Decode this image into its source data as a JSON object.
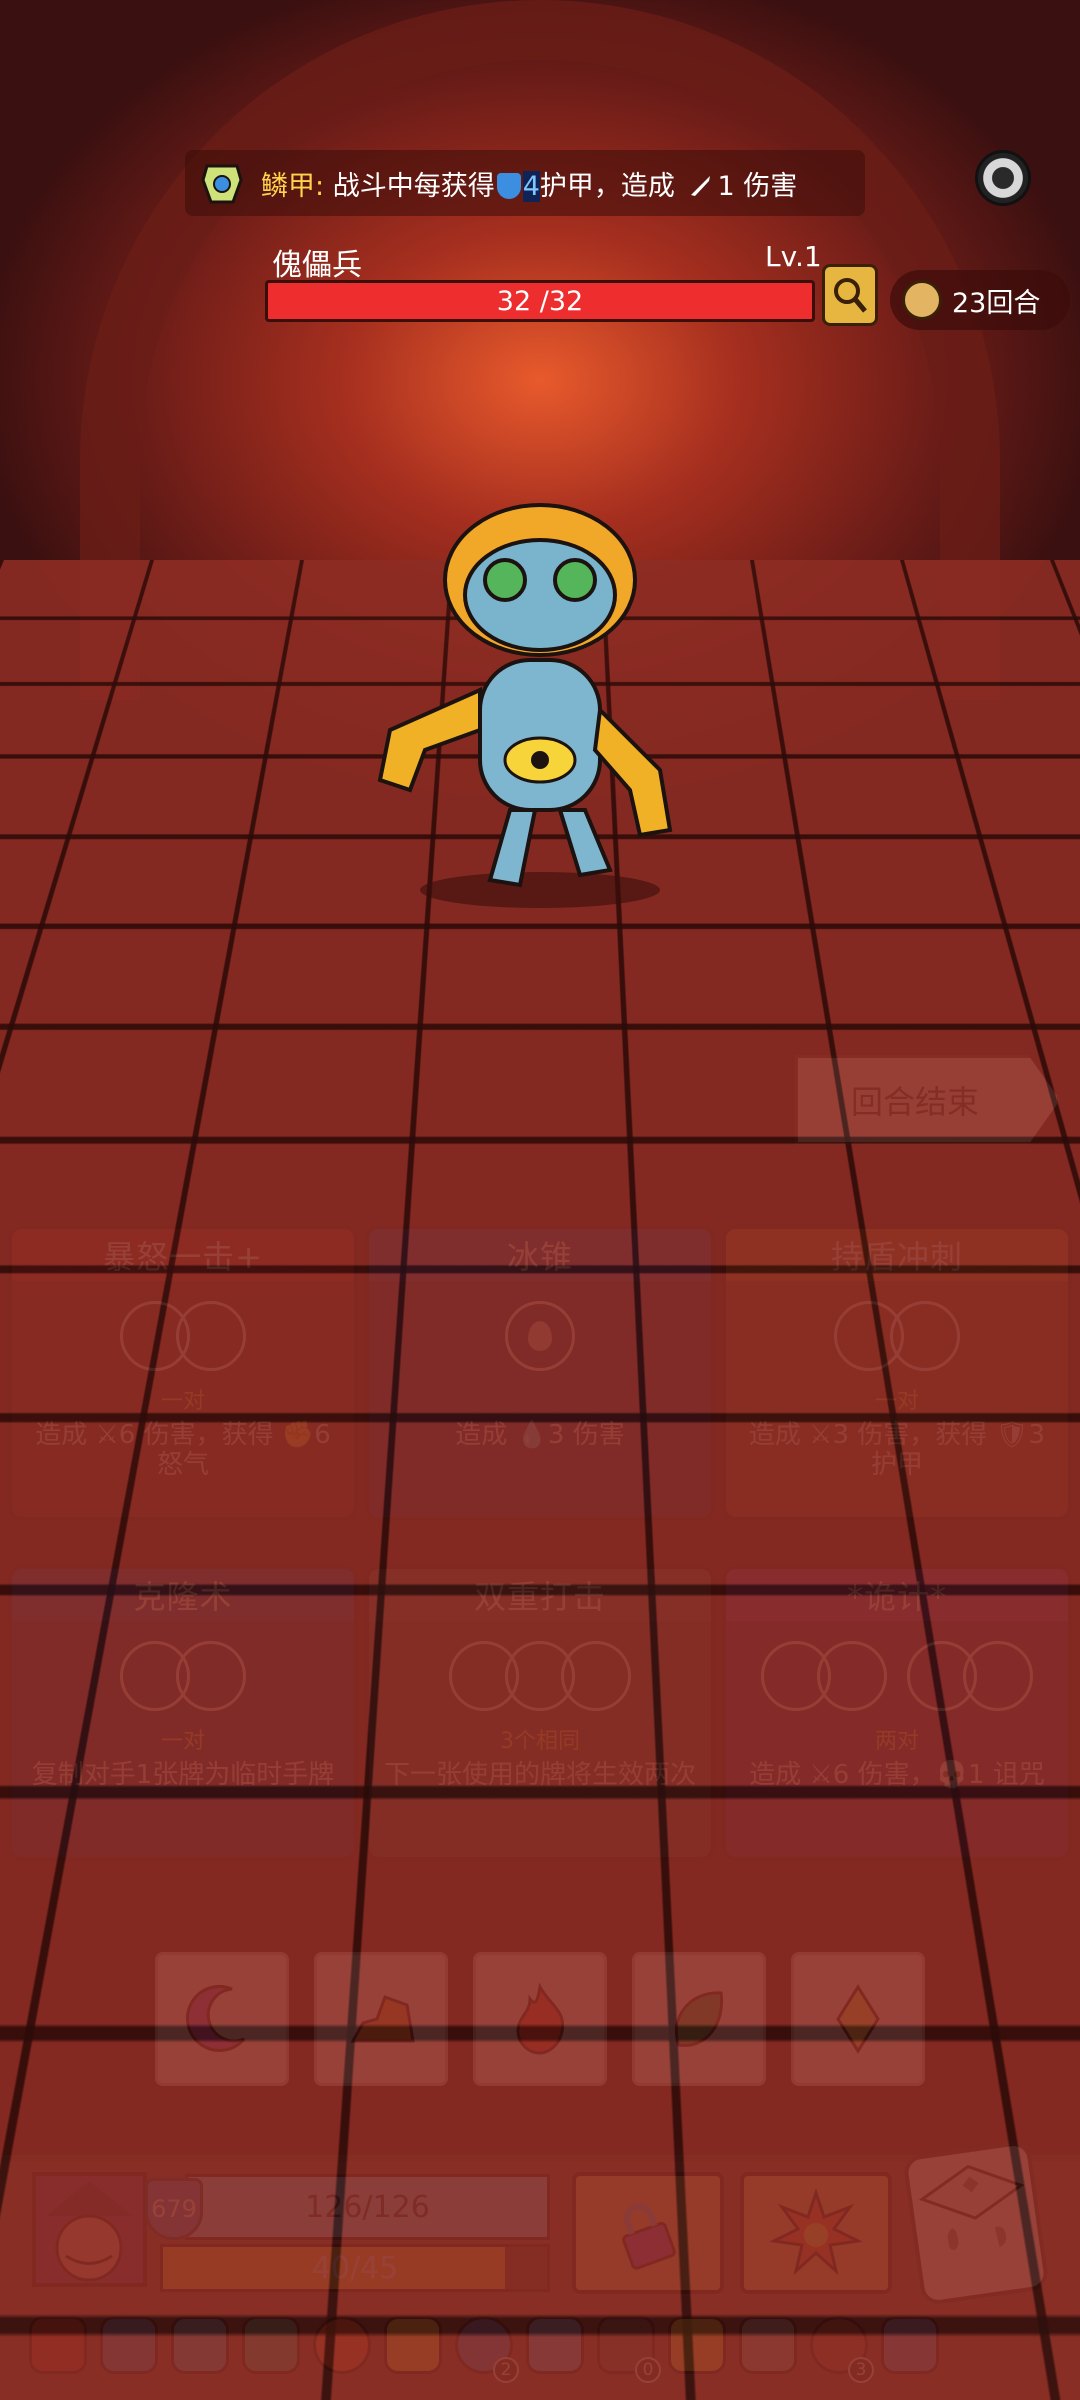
{
  "buff": {
    "name": "鳞甲",
    "colon": ":",
    "text_a": "战斗中每获得",
    "armor_amount": "4",
    "text_b": "护甲，造成",
    "damage_amount": "1",
    "text_c": "伤害"
  },
  "enemy": {
    "name": "傀儡兵",
    "level": "Lv.1",
    "hp": "32 /32"
  },
  "rounds": "23回合",
  "end_turn": "回合结束",
  "cards": [
    {
      "title": "暴怒一击+",
      "color": "red",
      "slots": 2,
      "requirement": "一对",
      "desc": "造成 ⚔6 伤害，获得 ✊6 怒气"
    },
    {
      "title": "冰锥",
      "color": "blue",
      "slots": 1,
      "requirement": "",
      "desc": "造成 💧3 伤害"
    },
    {
      "title": "持盾冲刺",
      "color": "orange",
      "slots": 2,
      "requirement": "一对",
      "desc": "造成 ⚔3 伤害，获得 🛡3 护甲"
    },
    {
      "title": "克隆术",
      "color": "blue",
      "slots": 2,
      "requirement": "一对",
      "desc": "复制对手1张牌为临时手牌"
    },
    {
      "title": "双重打击",
      "color": "gray",
      "slots": 3,
      "requirement": "3个相同",
      "desc": "下一张使用的牌将生效两次"
    },
    {
      "title": "*诡计*",
      "color": "purple",
      "slots": 4,
      "requirement": "两对",
      "desc": "造成 ⚔6 伤害，💀1 诅咒"
    }
  ],
  "dice": [
    "moon",
    "rock",
    "fire",
    "leaf",
    "diamond"
  ],
  "player": {
    "armor": "679",
    "hp": "126/126",
    "rage": "40/45",
    "rage_fraction": 0.89
  },
  "relic_badges": {
    "r10": "2",
    "r12": "0",
    "r15": "3"
  },
  "colors": {
    "hp_enemy": "#ee2e2e",
    "hp_player": "#6fd3f7",
    "rage": "#f8c12f"
  }
}
